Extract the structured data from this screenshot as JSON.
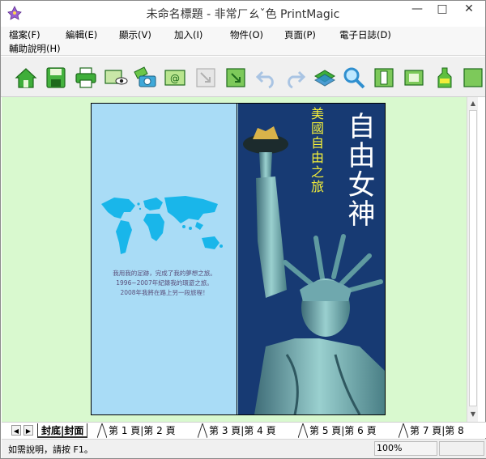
{
  "window": {
    "title": "未命名標題 - 非常ㄏㄠˇ色 PrintMagic",
    "controls": {
      "minimize": "—",
      "maximize": "□",
      "close": "✕"
    }
  },
  "menu": {
    "file": "檔案(F)",
    "edit": "編輯(E)",
    "view": "顯示(V)",
    "insert": "加入(I)",
    "object": "物件(O)",
    "page": "頁面(P)",
    "ediary": "電子日誌(D)",
    "help": "輔助說明(H)"
  },
  "toolbar": {
    "icons": [
      "home-icon",
      "save-icon",
      "print-icon",
      "preview-icon",
      "camera-icon",
      "email-icon",
      "image-import-icon",
      "image-export-icon",
      "undo-icon",
      "redo-icon",
      "layers-icon",
      "search-icon",
      "text-icon",
      "frame-icon",
      "bottle-icon",
      "more-icon"
    ]
  },
  "document": {
    "back_cover_text": [
      "我用我的足跡，完成了我的夢想之旅。",
      "1996~2007年紀錄我的環遊之旅。",
      "2008年我將在路上另一段旅程！"
    ],
    "front_title": "自由女神",
    "front_subtitle": "美國自由之旅"
  },
  "tabs": {
    "nav_prev": "◀",
    "nav_next": "▶",
    "items": [
      "封底|封面",
      "第 1 頁|第 2 頁",
      "第 3 頁|第 4 頁",
      "第 5 頁|第 6 頁",
      "第 7 頁|第 8"
    ]
  },
  "status": {
    "help_text": "如需說明，請按 F1。",
    "zoom": "100%"
  },
  "colors": {
    "workspace_bg": "#d9f9cf",
    "back_cover_bg": "#a9dcf6",
    "front_cover_bg": "#173a73",
    "subtitle": "#f2ed3a"
  }
}
